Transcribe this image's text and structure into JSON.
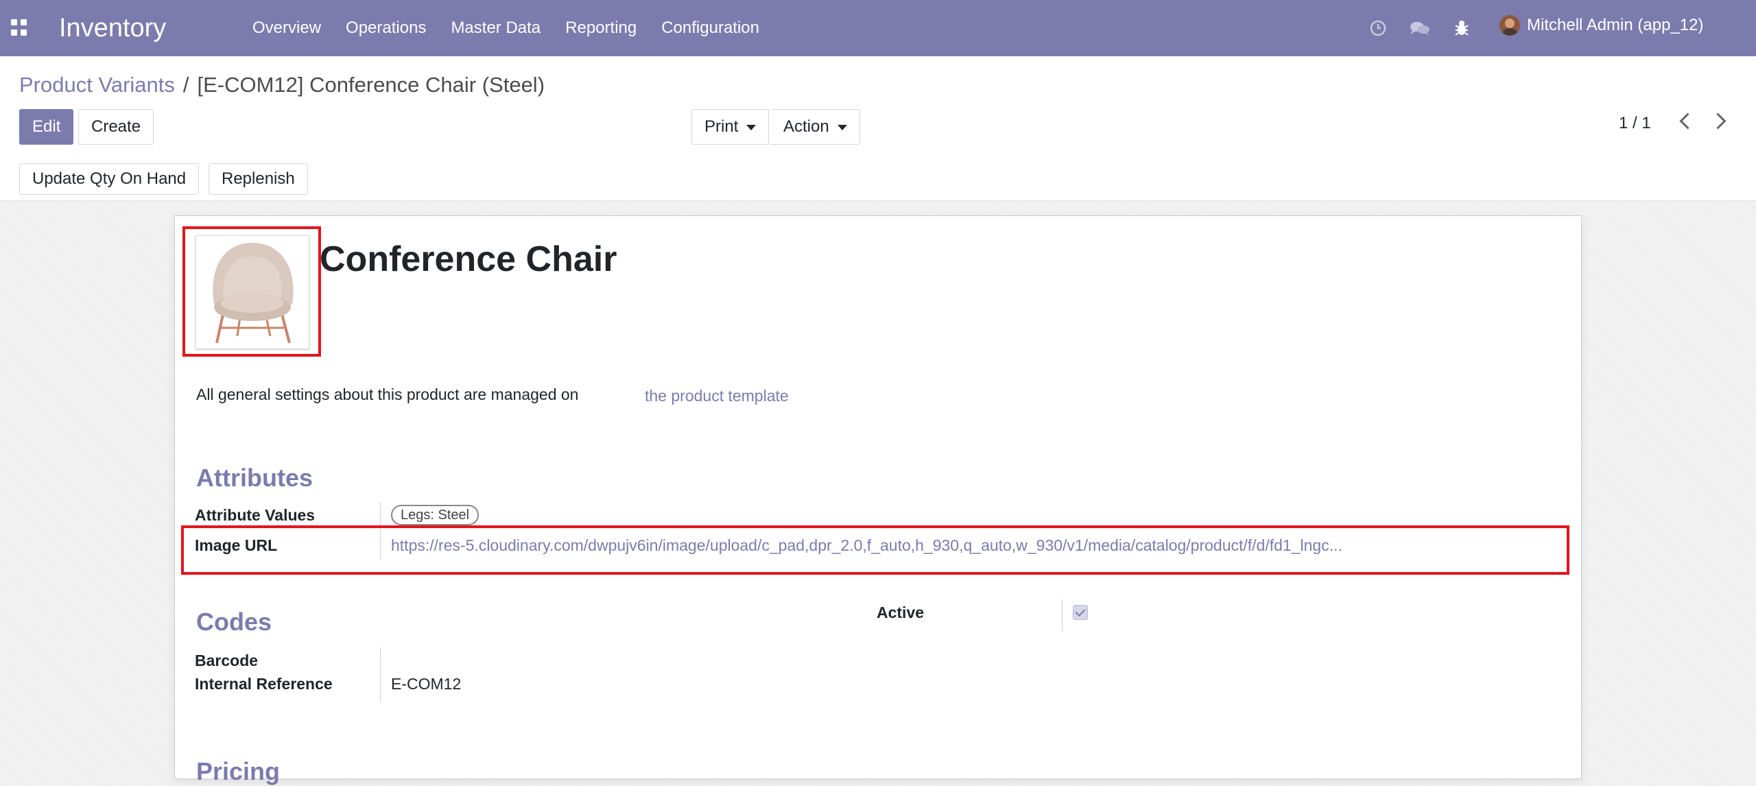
{
  "navbar": {
    "app_name": "Inventory",
    "menu": [
      "Overview",
      "Operations",
      "Master Data",
      "Reporting",
      "Configuration"
    ],
    "icons": [
      "clock-icon",
      "chat-icon",
      "bug-icon"
    ],
    "user": "Mitchell Admin (app_12)"
  },
  "breadcrumb": {
    "parent": "Product Variants",
    "separator": "/",
    "current": "[E-COM12] Conference Chair (Steel)"
  },
  "buttons": {
    "edit": "Edit",
    "create": "Create",
    "print": "Print",
    "action": "Action",
    "update_qty": "Update Qty On Hand",
    "replenish": "Replenish"
  },
  "pager": {
    "value": "1 / 1"
  },
  "form": {
    "product_name": "Conference Chair",
    "note_text": "All general settings about this product are managed on",
    "note_link": "the product template",
    "attributes": {
      "heading": "Attributes",
      "attribute_values_label": "Attribute Values",
      "attribute_tag": "Legs: Steel",
      "image_url_label": "Image URL",
      "image_url": "https://res-5.cloudinary.com/dwpujv6in/image/upload/c_pad,dpr_2.0,f_auto,h_930,q_auto,w_930/v1/media/catalog/product/f/d/fd1_lngc..."
    },
    "codes": {
      "heading": "Codes",
      "barcode_label": "Barcode",
      "barcode_value": "",
      "internal_ref_label": "Internal Reference",
      "internal_ref_value": "E-COM12",
      "active_label": "Active",
      "active": true
    },
    "next_heading": "Pricing"
  },
  "colors": {
    "brand": "#7c7bad",
    "highlight": "#e3141c"
  }
}
